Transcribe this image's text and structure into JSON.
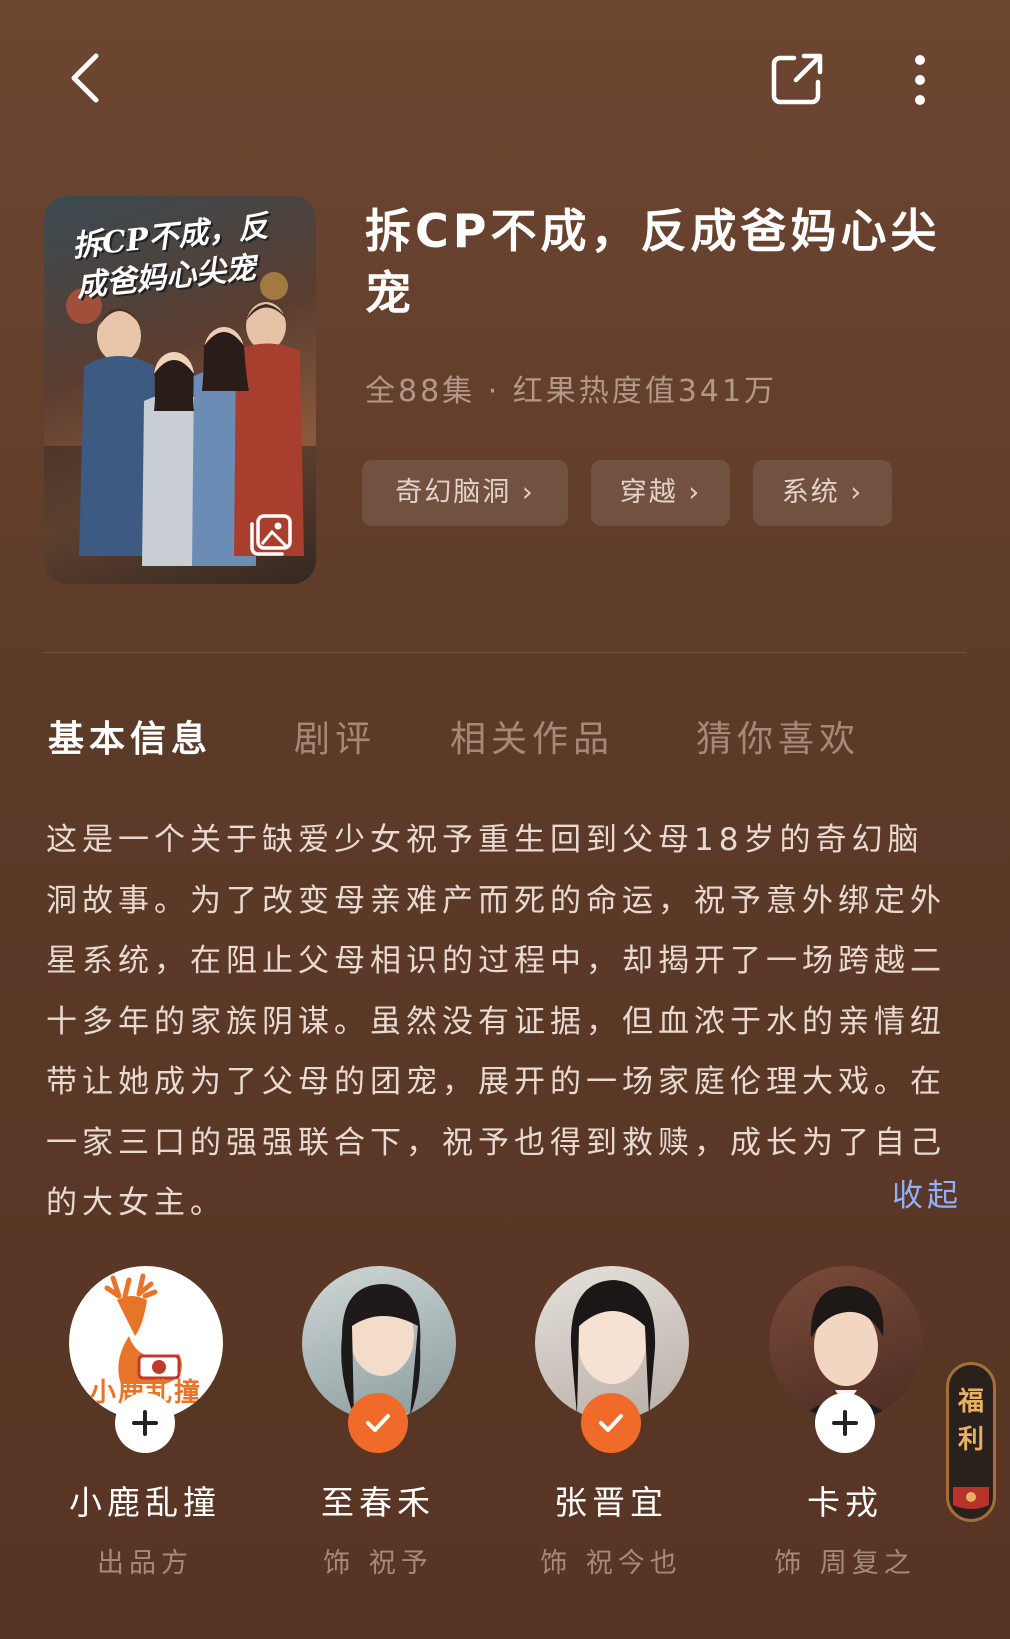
{
  "drama": {
    "title": "拆CP不成，反成爸妈心尖宠",
    "meta": "全88集 · 红果热度值341万",
    "poster_title": "拆CP不成，反成爸妈心尖宠"
  },
  "tags": [
    {
      "label": "奇幻脑洞 ›"
    },
    {
      "label": "穿越 ›"
    },
    {
      "label": "系统 ›"
    }
  ],
  "tabs": [
    {
      "label": "基本信息",
      "active": true
    },
    {
      "label": "剧评"
    },
    {
      "label": "相关作品"
    },
    {
      "label": "猜你喜欢"
    }
  ],
  "description": "这是一个关于缺爱少女祝予重生回到父母18岁的奇幻脑洞故事。为了改变母亲难产而死的命运，祝予意外绑定外星系统，在阻止父母相识的过程中，却揭开了一场跨越二十多年的家族阴谋。虽然没有证据，但血浓于水的亲情纽带让她成为了父母的团宠，展开的一场家庭伦理大戏。在一家三口的强强联合下，祝予也得到救赎，成长为了自己的大女主。",
  "collapse_label": "收起",
  "cast": [
    {
      "name": "小鹿乱撞",
      "role": "出品方",
      "badge": "plus-icon",
      "avatar_text": "小鹿乱撞"
    },
    {
      "name": "至春禾",
      "role": "饰 祝予",
      "badge": "check-icon"
    },
    {
      "name": "张晋宜",
      "role": "饰 祝今也",
      "badge": "check-icon"
    },
    {
      "name": "卡戎",
      "role": "饰 周复之",
      "badge": "plus-icon"
    }
  ],
  "fuli_label": "福利",
  "colors": {
    "accent": "#f06a2a",
    "link": "#8fb0ff",
    "background": "#5c3a28"
  }
}
